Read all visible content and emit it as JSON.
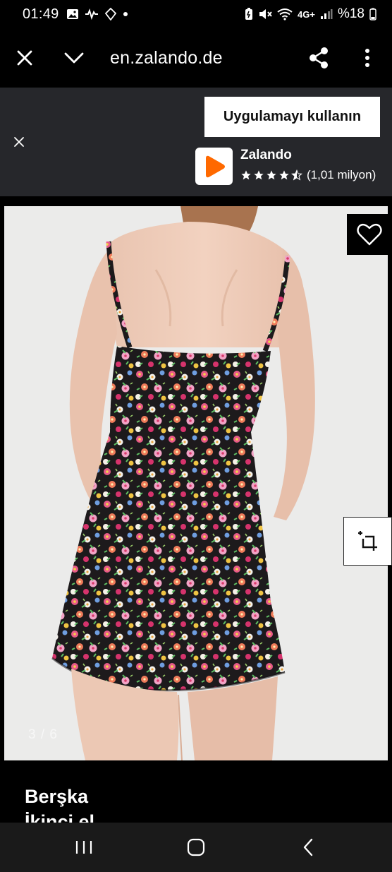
{
  "status_bar": {
    "time": "01:49",
    "battery": "%18",
    "network": "4G+"
  },
  "browser": {
    "url": "en.zalando.de"
  },
  "app_banner": {
    "use_app_label": "Uygulamayı kullanın",
    "app_name": "Zalando",
    "rating_count": "(1,01 milyon)",
    "rating_stars": 4.5,
    "logo_color": "#ff6900"
  },
  "product": {
    "image_counter": "3 / 6",
    "brand": "Berşka",
    "condition": "İkinci el"
  }
}
